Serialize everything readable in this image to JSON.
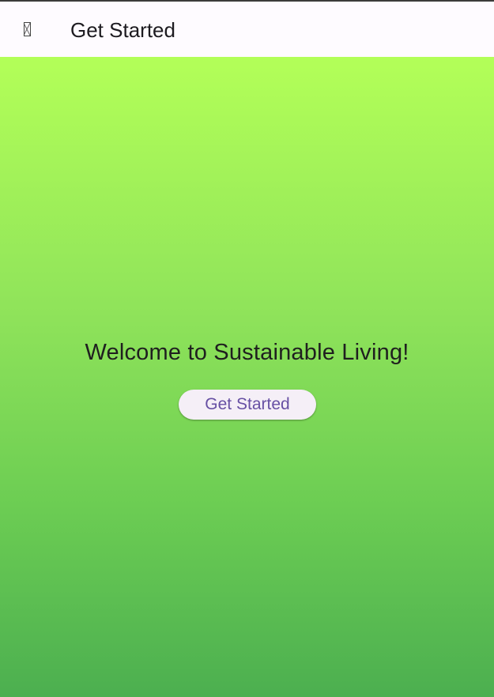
{
  "app_bar": {
    "title": "Get Started",
    "menu_icon": "missing-glyph-icon"
  },
  "main": {
    "welcome_text": "Welcome to Sustainable Living!",
    "cta_label": "Get Started"
  },
  "colors": {
    "app_bar_background": "#fefbff",
    "gradient_top": "#b3ff58",
    "gradient_bottom": "#4caf50",
    "button_background": "#f5eff7",
    "button_text": "#6750a4",
    "text_primary": "#1d1b20"
  }
}
